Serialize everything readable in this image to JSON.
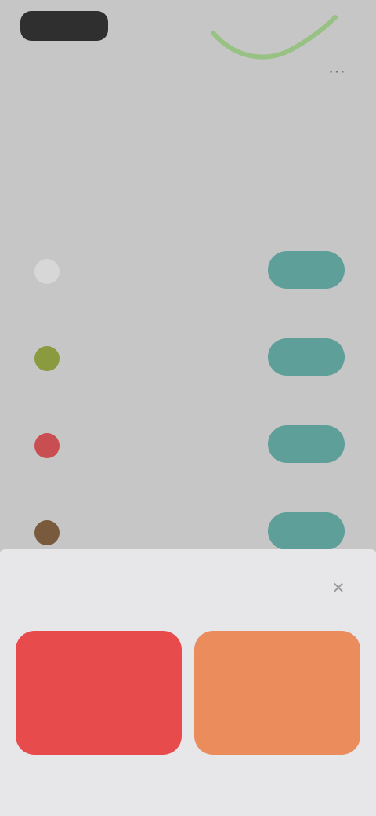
{
  "colors": {
    "background": "#c6c6c6",
    "accent_teal": "#5e9f99",
    "wave_green": "#8fc078",
    "card_red": "#e84b4b",
    "card_orange": "#ea8c5c",
    "sheet_bg": "#e7e6e9"
  },
  "header": {
    "status_text": "",
    "menu_icon": "more-icon"
  },
  "tabs": [
    {
      "label": ""
    },
    {
      "label": ""
    },
    {
      "label": ""
    }
  ],
  "section": {
    "label": ""
  },
  "list": {
    "items": [
      {
        "name": "",
        "button_label": "",
        "icon_color": "#d7d7d7"
      },
      {
        "name": "",
        "button_label": "",
        "icon_color": "#8a9a3e"
      },
      {
        "name": "",
        "button_label": "",
        "icon_color": "#c94e52"
      },
      {
        "name": "",
        "button_label": "",
        "icon_color": "#7a5a3c"
      }
    ]
  },
  "sheet": {
    "title": "",
    "close_icon": "close-icon",
    "cards": [
      {
        "label": "",
        "value": ""
      },
      {
        "label": "",
        "value": ""
      }
    ]
  }
}
